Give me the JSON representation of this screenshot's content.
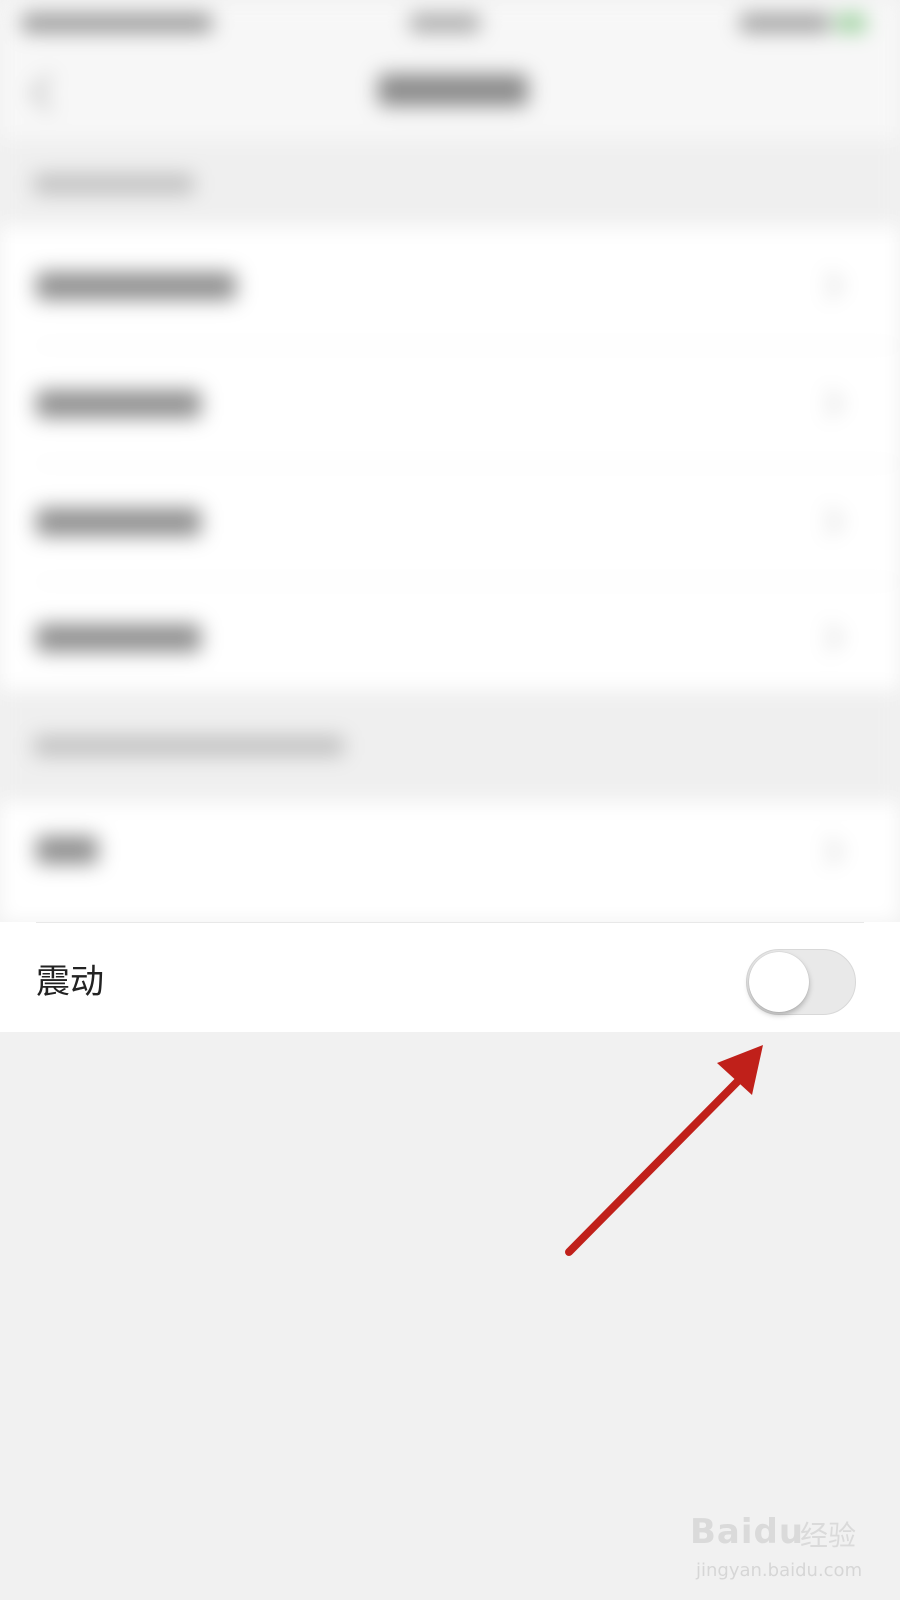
{
  "settings": {
    "vibrate_label": "震动",
    "vibrate_enabled": false
  },
  "colors": {
    "background": "#f1f1f1",
    "row_background": "#ffffff",
    "toggle_off": "#e9e9e9",
    "arrow": "#c0201a"
  },
  "watermark": {
    "logo": "Baidu",
    "name": "经验",
    "url": "jingyan.baidu.com"
  }
}
